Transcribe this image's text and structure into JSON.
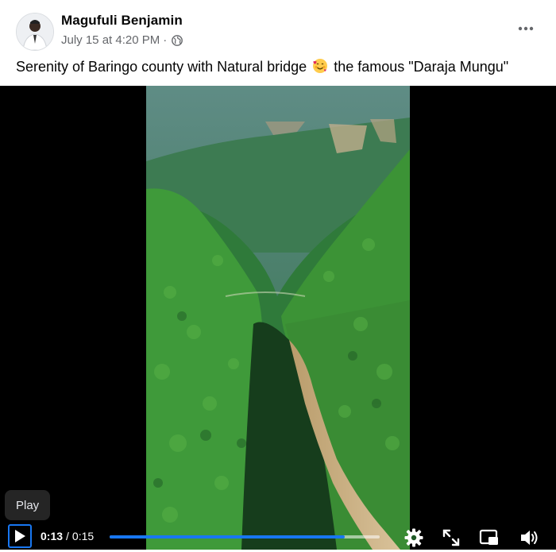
{
  "post": {
    "author_name": "Magufuli Benjamin",
    "timestamp": "July 15 at 4:20 PM",
    "separator": "·",
    "privacy_icon": "globe-icon",
    "more_icon": "more-dots-icon",
    "caption_before": "Serenity of Baringo county with Natural bridge",
    "caption_emoji": "smiling-face-with-hearts-emoji",
    "caption_after": "the famous \"Daraja Mungu\""
  },
  "video": {
    "tooltip": "Play",
    "current_time": "0:13",
    "time_separator": "/",
    "duration": "0:15",
    "progress": 0.87,
    "controls": [
      "play-icon",
      "settings-gear-icon",
      "fullscreen-icon",
      "picture-in-picture-icon",
      "volume-icon"
    ]
  },
  "colors": {
    "accent": "#1877f2",
    "text_primary": "#050505",
    "text_secondary": "#65676b",
    "video_background": "#000000"
  }
}
